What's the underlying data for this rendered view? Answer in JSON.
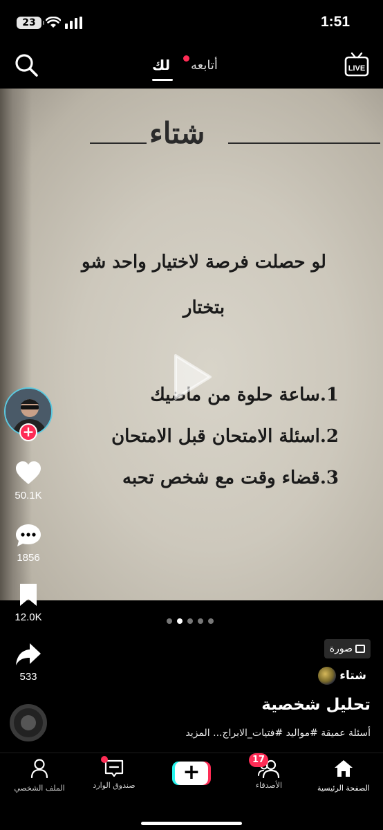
{
  "status_bar": {
    "battery": "23",
    "time": "1:51"
  },
  "top_nav": {
    "tab_for_you": "لك",
    "tab_following": "أتابعه",
    "live_label": "LIVE"
  },
  "post": {
    "book_header": "شتاء",
    "question_line1": "لو حصلت فرصة لاختيار واحد شو",
    "question_line2": "بتختار",
    "option1": "1.ساعة حلوة من ماضيك",
    "option2": "2.اسئلة الامتحان قبل الامتحان",
    "option3": "3.قضاء وقت مع شخص تحبه",
    "carousel": {
      "total": 5,
      "active_index": 1
    }
  },
  "actions": {
    "likes": "50.1K",
    "comments": "1856",
    "saves": "12.0K",
    "shares": "533",
    "follow_plus": "+"
  },
  "meta": {
    "photo_badge": "صورة",
    "author": "شتاء",
    "title": "تحليل شخصية",
    "caption": "أسئلة عميقة #مواليد #فتيات_الابراج... المزيد"
  },
  "tab_bar": {
    "home": "الصفحة الرئيسية",
    "friends": "الأصدقاء",
    "friends_badge": "17",
    "create": "+",
    "inbox": "صندوق الوارد",
    "profile": "الملف الشخصي"
  },
  "colors": {
    "accent_red": "#fe2c55",
    "accent_cyan": "#25f4ee",
    "avatar_ring": "#5cc9df"
  }
}
